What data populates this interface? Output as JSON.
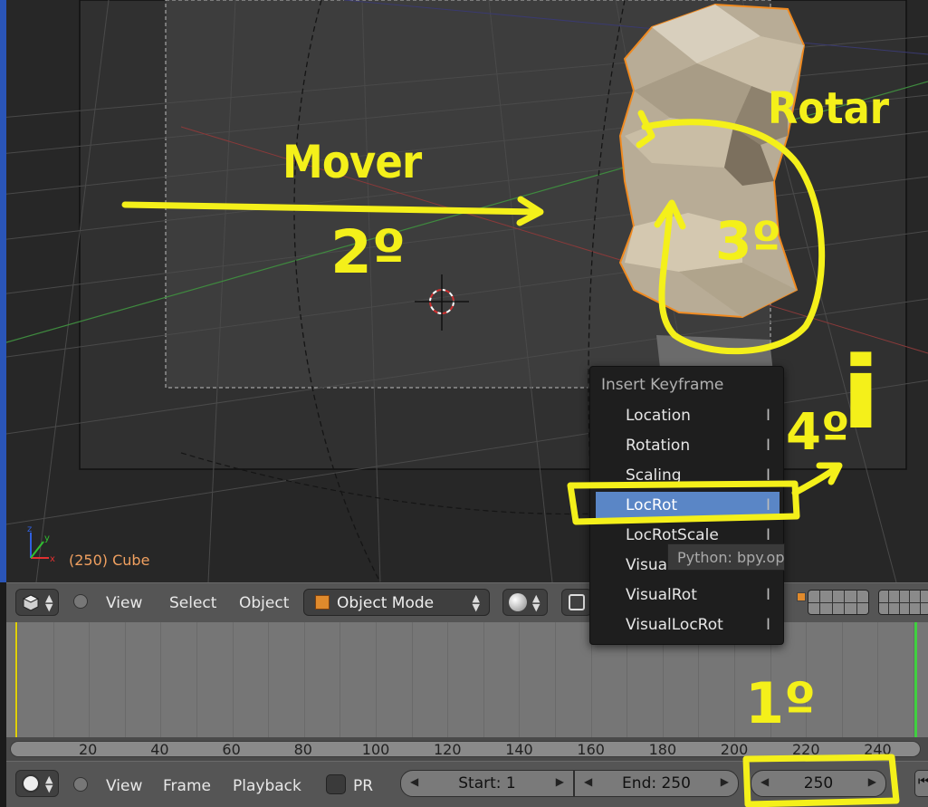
{
  "viewport": {
    "object_info": "(250) Cube",
    "axes": {
      "x": "x",
      "y": "y",
      "z": "z"
    }
  },
  "annotations": {
    "move": "Mover",
    "move_step": "2º",
    "rotate": "Rotar",
    "rotate_step": "3º",
    "insert_step": "4º",
    "insert_key": "i",
    "frame_step": "1º"
  },
  "view_header": {
    "menu_view": "View",
    "menu_select": "Select",
    "menu_object": "Object",
    "mode": "Object Mode"
  },
  "popup": {
    "title": "Insert Keyframe",
    "items": [
      {
        "label": "Location",
        "shortcut": "I"
      },
      {
        "label": "Rotation",
        "shortcut": "I"
      },
      {
        "label": "Scaling",
        "shortcut": "I"
      },
      {
        "label": "LocRot",
        "shortcut": "I",
        "highlighted": true
      },
      {
        "label": "LocRotScale",
        "shortcut": "I"
      },
      {
        "label": "VisualLoc",
        "shortcut": "I"
      },
      {
        "label": "VisualRot",
        "shortcut": "I"
      },
      {
        "label": "VisualLocRot",
        "shortcut": "I"
      }
    ],
    "tooltip": "Python: bpy.ops"
  },
  "timeline": {
    "ticks": [
      "20",
      "40",
      "60",
      "80",
      "100",
      "120",
      "140",
      "160",
      "180",
      "200",
      "220",
      "240"
    ],
    "current_frame": 250
  },
  "timeline_header": {
    "menu_view": "View",
    "menu_frame": "Frame",
    "menu_playback": "Playback",
    "pr_label": "PR",
    "start": "Start: 1",
    "end": "End: 250",
    "current": "250"
  },
  "colors": {
    "annotation": "#f4f01a",
    "selection_outline": "#f08a20",
    "menu_highlight": "#5a86c6",
    "object_info": "#f0a060",
    "current_frame_line": "#40d040"
  }
}
